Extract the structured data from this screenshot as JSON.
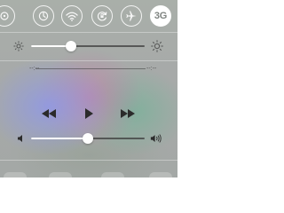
{
  "toggles": [
    {
      "name": "airplane-mode",
      "icon": "airplane-icon",
      "active": false
    },
    {
      "name": "wifi",
      "icon": "wifi-icon",
      "active": false
    },
    {
      "name": "bluetooth",
      "icon": "bluetooth-icon",
      "active": false
    },
    {
      "name": "do-not-disturb",
      "icon": "moon-icon",
      "active": false
    },
    {
      "name": "rotation-lock",
      "icon": "rotation-lock-icon",
      "active": false
    },
    {
      "name": "cellular-3g",
      "label": "3G",
      "active": true
    }
  ],
  "brightness": {
    "level": 0.35,
    "low_icon": "sun-small-icon",
    "high_icon": "sun-large-icon"
  },
  "now_playing": {
    "elapsed": "--:--",
    "remaining": "--:--",
    "controls": [
      "rewind-icon",
      "play-icon",
      "fast-forward-icon"
    ]
  },
  "volume": {
    "level": 0.5,
    "low_icon": "speaker-low-icon",
    "high_icon": "speaker-high-icon"
  },
  "colors": {
    "accent": "#ffffff",
    "inactive_track": "#3c3c3c",
    "active_toggle_text": "#7f8481"
  }
}
